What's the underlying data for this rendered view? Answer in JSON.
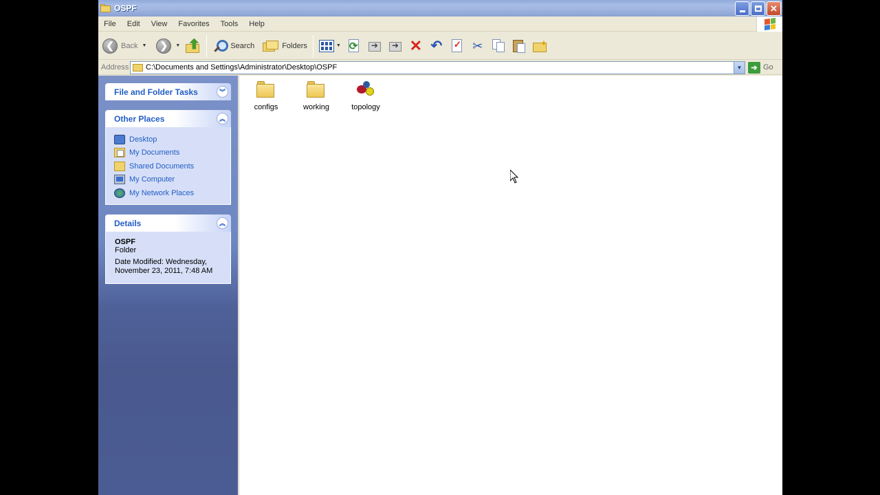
{
  "window": {
    "title": "OSPF"
  },
  "menu": [
    "File",
    "Edit",
    "View",
    "Favorites",
    "Tools",
    "Help"
  ],
  "toolbar": {
    "back_label": "Back",
    "search_label": "Search",
    "folders_label": "Folders"
  },
  "address": {
    "label": "Address",
    "value": "C:\\Documents and Settings\\Administrator\\Desktop\\OSPF",
    "go_label": "Go"
  },
  "panels": {
    "file_tasks": {
      "title": "File and Folder Tasks"
    },
    "other_places": {
      "title": "Other Places",
      "items": [
        {
          "label": "Desktop",
          "icon": "desktop-icon"
        },
        {
          "label": "My Documents",
          "icon": "my-documents-icon"
        },
        {
          "label": "Shared Documents",
          "icon": "shared-documents-icon"
        },
        {
          "label": "My Computer",
          "icon": "my-computer-icon"
        },
        {
          "label": "My Network Places",
          "icon": "network-places-icon"
        }
      ]
    },
    "details": {
      "title": "Details",
      "name": "OSPF",
      "type": "Folder",
      "modified": "Date Modified: Wednesday, November 23, 2011, 7:48 AM"
    }
  },
  "files": [
    {
      "label": "configs",
      "icon": "folder-icon"
    },
    {
      "label": "working",
      "icon": "folder-icon"
    },
    {
      "label": "topology",
      "icon": "topology-icon"
    }
  ],
  "colors": {
    "title_bar": "#9fb4df",
    "task_link": "#215dc6",
    "task_pane_bg": "#d6dff7",
    "left_pane_bg": "#6e87c1"
  }
}
